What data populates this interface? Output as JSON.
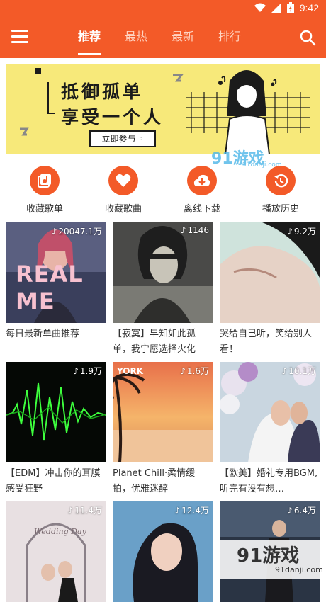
{
  "status_bar": {
    "time": "9:42"
  },
  "app_bar": {
    "tabs": [
      {
        "label": "推荐",
        "active": true
      },
      {
        "label": "最热",
        "active": false
      },
      {
        "label": "最新",
        "active": false
      },
      {
        "label": "排行",
        "active": false
      }
    ]
  },
  "banner": {
    "line1": "抵御孤单",
    "line2": "享受一个人",
    "button": "立即参与 ◦"
  },
  "watermark_top": {
    "text": "91游戏",
    "sub": "91danji.com"
  },
  "quick_actions": [
    {
      "label": "收藏歌单",
      "icon": "playlist-icon"
    },
    {
      "label": "收藏歌曲",
      "icon": "heart-icon"
    },
    {
      "label": "离线下载",
      "icon": "cloud-download-icon"
    },
    {
      "label": "播放历史",
      "icon": "history-icon"
    }
  ],
  "playlists": [
    {
      "title": "每日最新单曲推荐",
      "count": "20047.1万",
      "cover_text": "REAL ME"
    },
    {
      "title": "【寂寞】早知如此孤单，我宁愿选择火化",
      "count": "1146",
      "cover_text": ""
    },
    {
      "title": "哭给自己听，笑给别人看！",
      "count": "9.2万",
      "cover_text": ""
    },
    {
      "title": "【EDM】冲击你的耳膜 感受狂野",
      "count": "1.9万",
      "cover_text": ""
    },
    {
      "title": "Planet Chill·柔情缓拍，优雅迷醉",
      "count": "1.6万",
      "cover_text": "YORK"
    },
    {
      "title": "【欧美】婚礼专用BGM,听完有没有想…",
      "count": "10.1万",
      "cover_text": ""
    },
    {
      "title": "",
      "count": "11.4万",
      "cover_text": "Wedding Day"
    },
    {
      "title": "",
      "count": "12.4万",
      "cover_text": ""
    },
    {
      "title": "",
      "count": "6.4万",
      "cover_text": ""
    }
  ],
  "watermark_bottom": {
    "text": "91游戏",
    "sub": "91danji.com"
  },
  "colors": {
    "accent": "#f35a28",
    "banner_bg": "#f7e97a"
  }
}
